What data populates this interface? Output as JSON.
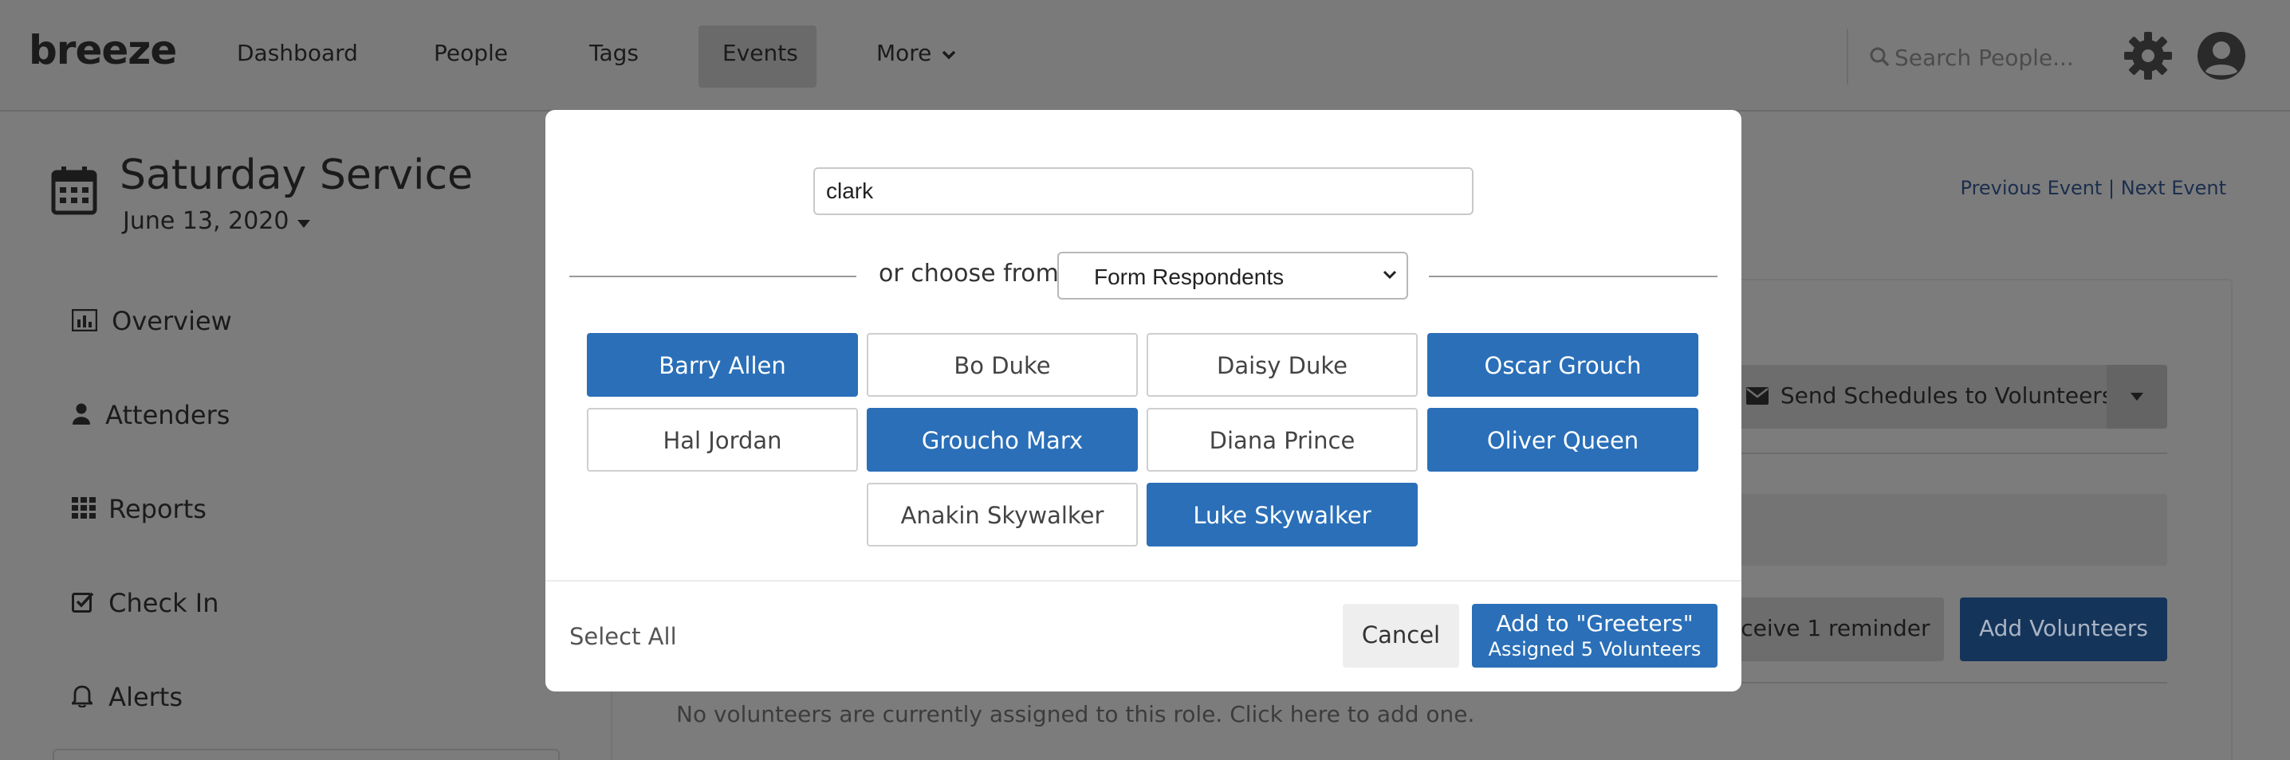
{
  "brand": {
    "logo": "breeze"
  },
  "nav": {
    "items": [
      "Dashboard",
      "People",
      "Tags",
      "Events",
      "More"
    ],
    "active": "Events",
    "search_placeholder": "Search People...",
    "icons": [
      "search-icon",
      "gear-icon",
      "user-avatar-icon",
      "chevron-down-icon"
    ]
  },
  "event": {
    "title": "Saturday Service",
    "date": "June 13, 2020",
    "previous_link": "Previous Event",
    "separator": "|",
    "next_link": "Next Event"
  },
  "sidebar": {
    "items": [
      {
        "label": "Overview",
        "icon": "bar-chart-icon"
      },
      {
        "label": "Attenders",
        "icon": "user-icon"
      },
      {
        "label": "Reports",
        "icon": "grid-icon"
      },
      {
        "label": "Check In",
        "icon": "checkbox-icon"
      },
      {
        "label": "Alerts",
        "icon": "bell-icon"
      }
    ]
  },
  "background_content": {
    "send_schedules_label": "Send Schedules to Volunteers",
    "reminder_label": "eceive 1 reminder",
    "add_volunteers_label": "Add Volunteers",
    "empty_message": "No volunteers are currently assigned to this role. Click here to add one."
  },
  "modal": {
    "search_value": "clark",
    "choose_label": "or choose from",
    "choose_selected": "Form Respondents",
    "people": [
      {
        "name": "Barry Allen",
        "selected": true
      },
      {
        "name": "Bo Duke",
        "selected": false
      },
      {
        "name": "Daisy Duke",
        "selected": false
      },
      {
        "name": "Oscar Grouch",
        "selected": true
      },
      {
        "name": "Hal Jordan",
        "selected": false
      },
      {
        "name": "Groucho Marx",
        "selected": true
      },
      {
        "name": "Diana Prince",
        "selected": false
      },
      {
        "name": "Oliver Queen",
        "selected": true
      },
      {
        "name": "Anakin Skywalker",
        "selected": false
      },
      {
        "name": "Luke Skywalker",
        "selected": true
      }
    ],
    "select_all_label": "Select All",
    "cancel_label": "Cancel",
    "add_label": "Add to \"Greeters\"",
    "add_sublabel": "Assigned 5 Volunteers"
  },
  "colors": {
    "primary": "#2a6fb8",
    "overlay_background": "#7c7c7c",
    "dark_button": "#15345a"
  }
}
